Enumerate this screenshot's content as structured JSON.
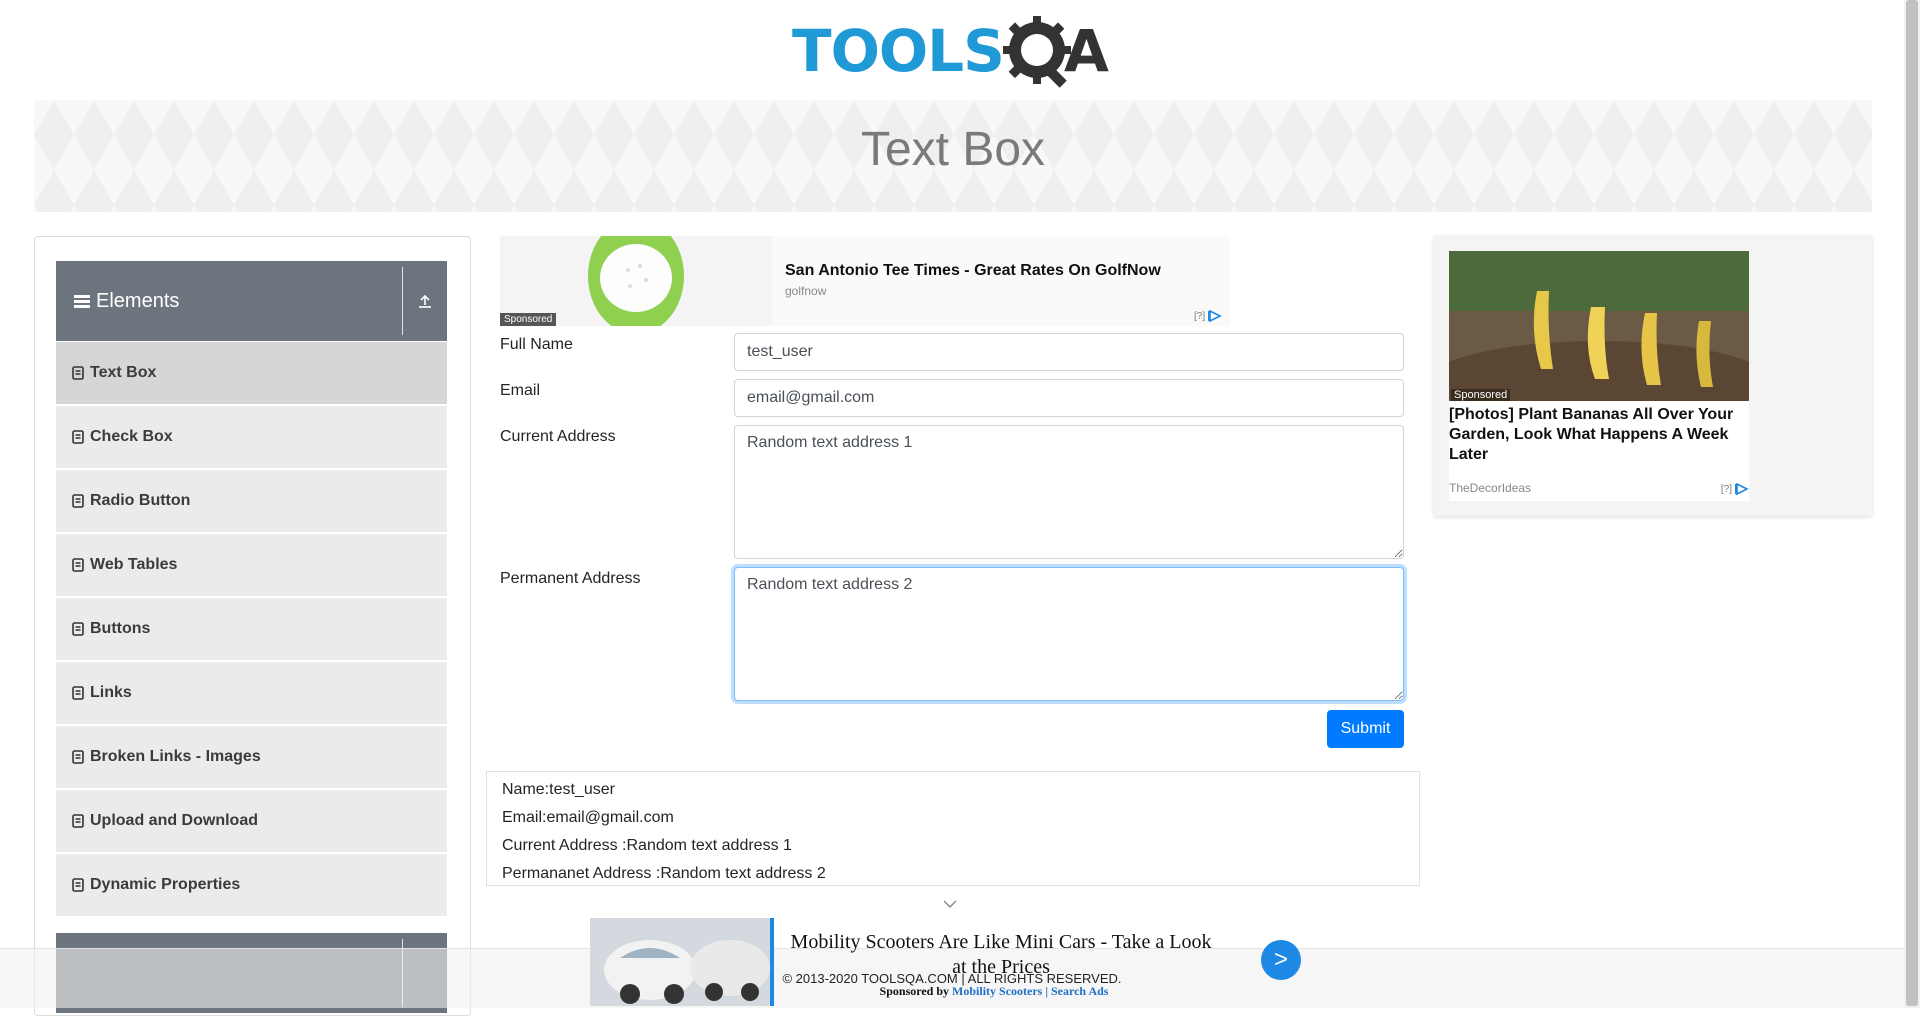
{
  "logo": {
    "text": "TOOLS",
    "text_a": "A",
    "alt": "TOOLSQA"
  },
  "banner": {
    "title": "Text Box"
  },
  "sidebar": {
    "group": {
      "label": "Elements"
    },
    "items": [
      {
        "label": "Text Box",
        "active": true
      },
      {
        "label": "Check Box"
      },
      {
        "label": "Radio Button"
      },
      {
        "label": "Web Tables"
      },
      {
        "label": "Buttons"
      },
      {
        "label": "Links"
      },
      {
        "label": "Broken Links - Images"
      },
      {
        "label": "Upload and Download"
      },
      {
        "label": "Dynamic Properties"
      }
    ]
  },
  "top_ad": {
    "title": "San Antonio Tee Times - Great Rates On GolfNow",
    "source": "golfnow",
    "sponsored": "Sponsored",
    "info": "[?]"
  },
  "form": {
    "full_name": {
      "label": "Full Name",
      "value": "test_user"
    },
    "email": {
      "label": "Email",
      "value": "email@gmail.com"
    },
    "current_address": {
      "label": "Current Address",
      "value": "Random text address 1"
    },
    "permanent_address": {
      "label": "Permanent Address",
      "value": "Random text address 2"
    },
    "submit_label": "Submit"
  },
  "output": {
    "name": "Name:test_user",
    "email": "Email:email@gmail.com",
    "current_address": "Current Address :Random text address 1",
    "permanent_address": "Permananet Address :Random text address 2"
  },
  "right_ad": {
    "sponsored": "Sponsored",
    "title": "[Photos] Plant Bananas All Over Your Garden, Look What Happens A Week Later",
    "source": "TheDecorIdeas",
    "info": "[?]"
  },
  "bottom_ad": {
    "title": "Mobility Scooters Are Like Mini Cars - Take a Look at the Prices",
    "button": ">",
    "sponsored_by": "Sponsored by",
    "sponsor_link": "Mobility Scooters | Search Ads"
  },
  "footer": {
    "text": "© 2013-2020 TOOLSQA.COM | ALL RIGHTS RESERVED."
  },
  "colors": {
    "primary": "#007bff",
    "brand_blue": "#1f9ad6",
    "sidebar_header": "#6c757d"
  },
  "icons": {
    "sidebar_group": "hamburger-icon",
    "sidebar_toggle": "collapse-up-icon",
    "menu_item": "clipboard-icon",
    "ad_choices": "adchoices-icon",
    "chevron": "chevron-down-icon"
  }
}
